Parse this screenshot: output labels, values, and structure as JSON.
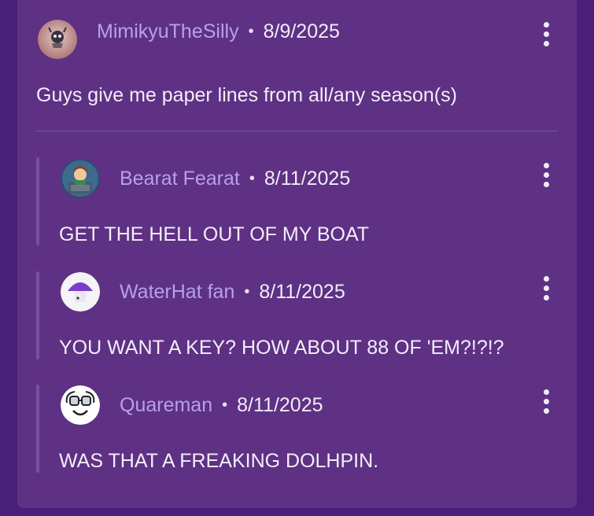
{
  "post": {
    "username": "MimikyuTheSilly",
    "separator": "•",
    "date": "8/9/2025",
    "text": "Guys give me paper lines from all/any season(s)"
  },
  "replies": [
    {
      "username": "Bearat Fearat",
      "separator": "•",
      "date": "8/11/2025",
      "text": "GET THE HELL OUT OF MY BOAT"
    },
    {
      "username": "WaterHat fan",
      "separator": "•",
      "date": "8/11/2025",
      "text": "YOU WANT A KEY? HOW ABOUT 88 OF 'EM?!?!?"
    },
    {
      "username": "Quareman",
      "separator": "•",
      "date": "8/11/2025",
      "text": "WAS THAT A FREAKING DOLHPIN."
    }
  ],
  "colors": {
    "background": "#4a1f7a",
    "card": "#5e3184",
    "username": "#b8a0e8",
    "text": "#f3eef8"
  },
  "icons": {
    "menu": "kebab-menu-icon"
  }
}
